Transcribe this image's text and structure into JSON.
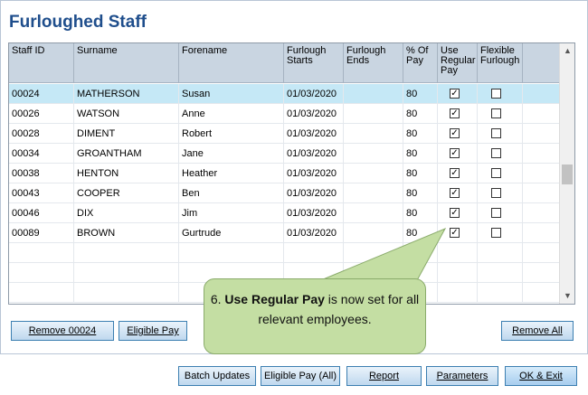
{
  "page": {
    "title": "Furloughed Staff"
  },
  "table": {
    "columns": [
      "Staff ID",
      "Surname",
      "Forename",
      "Furlough Starts",
      "Furlough Ends",
      "% Of Pay",
      "Use Regular Pay",
      "Flexible Furlough"
    ],
    "column_lines": [
      [
        "Staff ID"
      ],
      [
        "Surname"
      ],
      [
        "Forename"
      ],
      [
        "Furlough",
        "Starts"
      ],
      [
        "Furlough",
        "Ends"
      ],
      [
        "% Of",
        "Pay"
      ],
      [
        "Use",
        "Regular",
        "Pay"
      ],
      [
        "Flexible",
        "Furlough"
      ]
    ],
    "rows": [
      {
        "id": "00024",
        "surname": "MATHERSON",
        "forename": "Susan",
        "start": "01/03/2020",
        "end": "",
        "pct": "80",
        "regular": true,
        "flexible": false,
        "selected": true
      },
      {
        "id": "00026",
        "surname": "WATSON",
        "forename": "Anne",
        "start": "01/03/2020",
        "end": "",
        "pct": "80",
        "regular": true,
        "flexible": false
      },
      {
        "id": "00028",
        "surname": "DIMENT",
        "forename": "Robert",
        "start": "01/03/2020",
        "end": "",
        "pct": "80",
        "regular": true,
        "flexible": false
      },
      {
        "id": "00034",
        "surname": "GROANTHAM",
        "forename": "Jane",
        "start": "01/03/2020",
        "end": "",
        "pct": "80",
        "regular": true,
        "flexible": false
      },
      {
        "id": "00038",
        "surname": "HENTON",
        "forename": "Heather",
        "start": "01/03/2020",
        "end": "",
        "pct": "80",
        "regular": true,
        "flexible": false
      },
      {
        "id": "00043",
        "surname": "COOPER",
        "forename": "Ben",
        "start": "01/03/2020",
        "end": "",
        "pct": "80",
        "regular": true,
        "flexible": false
      },
      {
        "id": "00046",
        "surname": "DIX",
        "forename": "Jim",
        "start": "01/03/2020",
        "end": "",
        "pct": "80",
        "regular": true,
        "flexible": false
      },
      {
        "id": "00089",
        "surname": "BROWN",
        "forename": "Gurtrude",
        "start": "01/03/2020",
        "end": "",
        "pct": "80",
        "regular": true,
        "flexible": false
      }
    ],
    "empty_rows": 3,
    "check_glyph": "☑"
  },
  "buttons": {
    "remove": "Remove 00024",
    "eligible_pay": "Eligible Pay",
    "remove_all": "Remove All",
    "batch_updates": "Batch Updates",
    "eligible_pay_all": "Eligible Pay (All)",
    "report": "Report",
    "parameters": "Parameters",
    "ok_exit": "OK & Exit"
  },
  "callout": {
    "prefix": "6. ",
    "bold": "Use Regular Pay",
    "rest": " is now set for all relevant employees."
  },
  "icons": {
    "scroll_up": "chevron-up-icon",
    "scroll_down": "chevron-down-icon"
  }
}
